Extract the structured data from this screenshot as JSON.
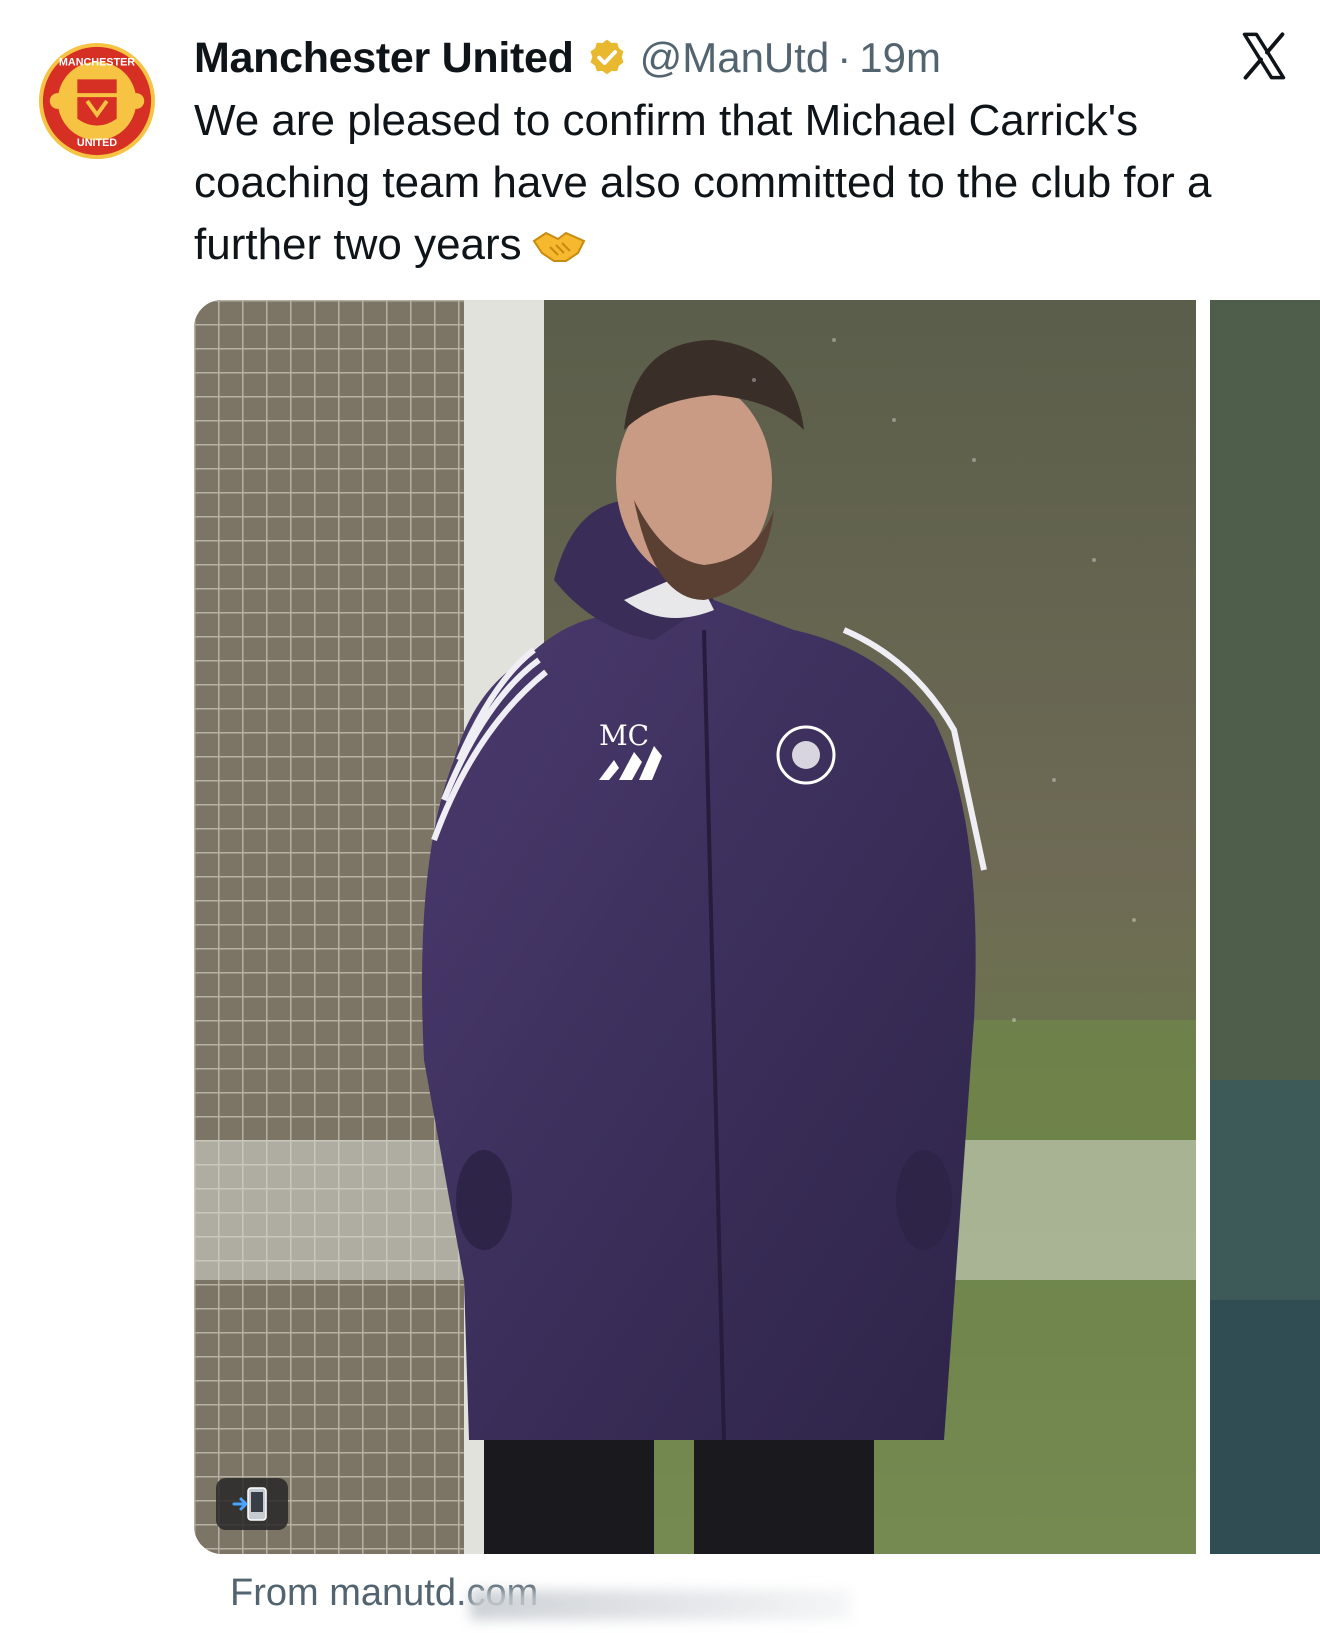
{
  "account": {
    "display_name": "Manchester United",
    "handle": "@ManUtd",
    "separator": "·",
    "time": "19m",
    "avatar_icon": "manchester-united-crest",
    "verified_icon": "verified-gold-badge"
  },
  "tweet": {
    "text": "We are pleased to confirm that Michael Carrick's coaching team have also committed to the club for a further two years",
    "emoji_icon": "handshake-emoji"
  },
  "media": {
    "jacket_initials": "MC",
    "app_badge_icon": "mobile-phone-arrow-icon"
  },
  "footer": {
    "source_text": "From manutd.com"
  },
  "colors": {
    "text_primary": "#0f1419",
    "text_secondary": "#536471",
    "verified_gold": "#e8b82e",
    "jacket_purple": "#3b2d5a"
  }
}
